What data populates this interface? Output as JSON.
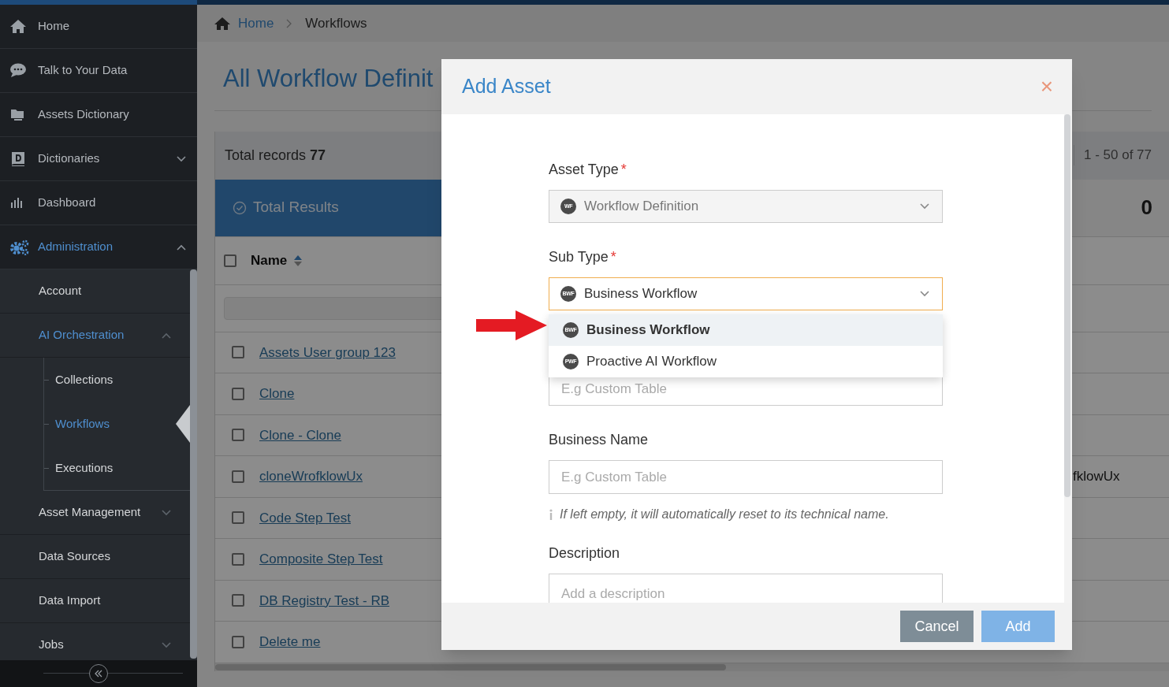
{
  "sidebar": {
    "items": [
      {
        "label": "Home",
        "selected": false
      },
      {
        "label": "Talk to Your Data",
        "selected": false
      },
      {
        "label": "Assets Dictionary",
        "selected": false
      },
      {
        "label": "Dictionaries",
        "selected": false,
        "expanded": false
      },
      {
        "label": "Dashboard",
        "selected": false
      },
      {
        "label": "Administration",
        "selected": true,
        "expanded": true,
        "children": [
          {
            "label": "Account",
            "selected": false
          },
          {
            "label": "AI Orchestration",
            "selected": true,
            "expanded": true,
            "children": [
              {
                "label": "Collections",
                "selected": false
              },
              {
                "label": "Workflows",
                "selected": true
              },
              {
                "label": "Executions",
                "selected": false
              }
            ]
          },
          {
            "label": "Asset Management",
            "selected": false,
            "expanded": false
          },
          {
            "label": "Data Sources",
            "selected": false
          },
          {
            "label": "Data Import",
            "selected": false
          },
          {
            "label": "Jobs",
            "selected": false,
            "expanded": false
          }
        ]
      }
    ]
  },
  "breadcrumb": [
    "Home",
    "Workflows"
  ],
  "page_title": "All Workflow Definit",
  "records": {
    "total": "Total records **77**",
    "range": "1 - 50 of 77"
  },
  "summary": {
    "label": "Total Results",
    "count": "0"
  },
  "table": {
    "columns": [
      "Name"
    ],
    "header_checked": false,
    "rows": [
      {
        "name": "Assets User group 123",
        "checked": false
      },
      {
        "name": "Clone",
        "checked": false
      },
      {
        "name": "Clone - Clone",
        "checked": false
      },
      {
        "name": "cloneWrofklowUx",
        "checked": false,
        "column_2": "fklowUx"
      },
      {
        "name": "Code Step Test",
        "checked": false
      },
      {
        "name": "Composite Step Test",
        "checked": false
      },
      {
        "name": "DB Registry Test - RB",
        "checked": false
      },
      {
        "name": "Delete me",
        "checked": false
      }
    ]
  },
  "modal": {
    "title": "Add Asset",
    "close": "×",
    "fields": [
      {
        "kind": "select",
        "label": "Asset Type",
        "required_mark": "*",
        "value": "Workflow Definition",
        "badge": "WF",
        "disabled": true,
        "focused": false
      },
      {
        "kind": "select",
        "label": "Sub Type",
        "required_mark": "*",
        "value": "Business Workflow",
        "badge": "BWF",
        "disabled": false,
        "focused": true,
        "options": [
          {
            "label": "Business Workflow",
            "badge": "BWF",
            "selected": true
          },
          {
            "label": "Proactive AI Workflow",
            "badge": "PWF",
            "selected": false
          }
        ]
      },
      {
        "kind": "text",
        "placeholder": "E.g Custom Table"
      },
      {
        "kind": "text",
        "label": "Business Name",
        "placeholder": "E.g Custom Table",
        "hint": "If left empty, it will automatically reset to its technical name."
      },
      {
        "kind": "textarea",
        "label": "Description",
        "placeholder": "Add a description"
      }
    ],
    "buttons": [
      {
        "label": "Cancel",
        "kind": "secondary",
        "disabled": false
      },
      {
        "label": "Add",
        "kind": "primary",
        "disabled": true
      }
    ]
  }
}
